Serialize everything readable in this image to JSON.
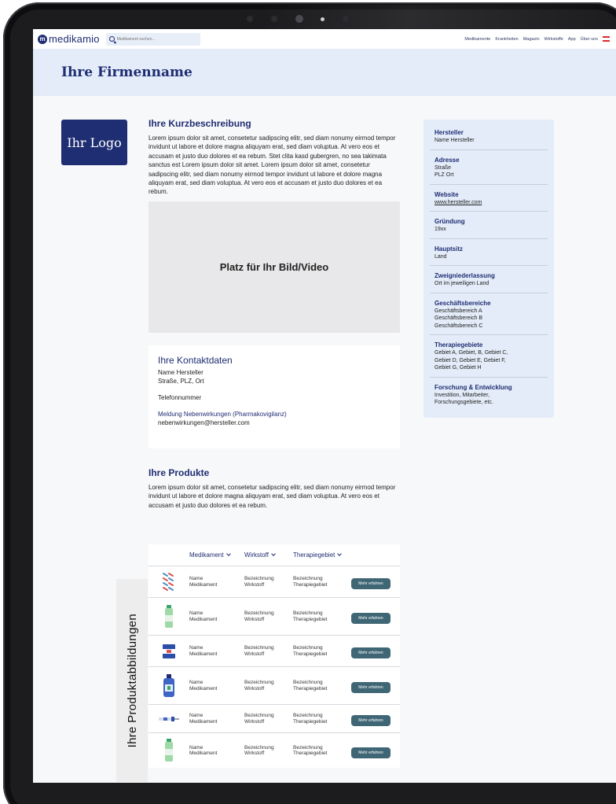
{
  "nav": {
    "brand": "medikamio",
    "brand_mark": "m",
    "search_placeholder": "Medikament suchen...",
    "links": [
      "Medikamente",
      "Krankheiten",
      "Magazin",
      "Wirkstoffe",
      "App",
      "Über uns"
    ]
  },
  "header": {
    "company_name": "Ihre Firmenname"
  },
  "logo": {
    "text": "Ihr Logo"
  },
  "intro": {
    "title": "Ihre Kurzbeschreibung",
    "text": "Lorem ipsum dolor sit amet, consetetur sadipscing elitr, sed diam nonumy eirmod tempor invidunt ut labore et dolore magna aliquyam erat, sed diam voluptua. At vero eos et accusam et justo duo dolores et ea rebum. Stet clita kasd gubergren, no sea takimata sanctus est Lorem ipsum dolor sit amet. Lorem ipsum dolor sit amet, consetetur sadipscing elitr, sed diam nonumy eirmod tempor invidunt ut labore et dolore magna aliquyam erat, sed diam voluptua. At vero eos et accusam et justo duo dolores et ea rebum."
  },
  "media": {
    "placeholder": "Platz für Ihr Bild/Video"
  },
  "contact": {
    "title": "Ihre Kontaktdaten",
    "name": "Name Hersteller",
    "address": "Straße, PLZ, Ort",
    "phone": "Telefonnummer",
    "side_effects_label": "Meldung Nebenwirkungen (Pharmakovigilanz)",
    "email": "nebenwirkungen@hersteller.com"
  },
  "products": {
    "title": "Ihre Produkte",
    "text": "Lorem ipsum dolor sit amet, consetetur sadipscing elitr, sed diam nonumy eirmod tempor invidunt ut labore et dolore magna aliquyam erat, sed diam voluptua. At vero eos et accusam et justo duo dolores et ea rebum.",
    "side_tab": "Ihre Produktabbildungen",
    "columns": [
      "Medikament",
      "Wirkstoff",
      "Therapiegebiet"
    ],
    "rows": [
      {
        "icon": "blister-pack-icon",
        "name1": "Name",
        "name2": "Medikament",
        "wirk1": "Bezeichnung",
        "wirk2": "Wirkstoff",
        "thera1": "Bezeichnung",
        "thera2": "Therapiegebiet",
        "button": "Mehr erfahren"
      },
      {
        "icon": "green-bottle-icon",
        "name1": "Name",
        "name2": "Medikament",
        "wirk1": "Bezeichnung",
        "wirk2": "Wirkstoff",
        "thera1": "Bezeichnung",
        "thera2": "Therapiegebiet",
        "button": "Mehr erfahren"
      },
      {
        "icon": "medicine-box-icon",
        "name1": "Name",
        "name2": "Medikament",
        "wirk1": "Bezeichnung",
        "wirk2": "Wirkstoff",
        "thera1": "Bezeichnung",
        "thera2": "Therapiegebiet",
        "button": "Mehr erfahren"
      },
      {
        "icon": "blue-bottle-icon",
        "name1": "Name",
        "name2": "Medikament",
        "wirk1": "Bezeichnung",
        "wirk2": "Wirkstoff",
        "thera1": "Bezeichnung",
        "thera2": "Therapiegebiet",
        "button": "Mehr erfahren"
      },
      {
        "icon": "syringe-icon",
        "name1": "Name",
        "name2": "Medikament",
        "wirk1": "Bezeichnung",
        "wirk2": "Wirkstoff",
        "thera1": "Bezeichnung",
        "thera2": "Therapiegebiet",
        "button": "Mehr erfahren"
      },
      {
        "icon": "green-bottle-icon",
        "name1": "Name",
        "name2": "Medikament",
        "wirk1": "Bezeichnung",
        "wirk2": "Wirkstoff",
        "thera1": "Bezeichnung",
        "thera2": "Therapiegebiet",
        "button": "Mehr erfahren"
      }
    ]
  },
  "info": [
    {
      "label": "Hersteller",
      "lines": [
        "Name Hersteller"
      ]
    },
    {
      "label": "Adresse",
      "lines": [
        "Straße",
        "PLZ Ort"
      ]
    },
    {
      "label": "Website",
      "lines": [
        "www.hersteller.com"
      ],
      "link": true
    },
    {
      "label": "Gründung",
      "lines": [
        "19xx"
      ]
    },
    {
      "label": "Hauptsitz",
      "lines": [
        "Land"
      ]
    },
    {
      "label": "Zweigniederlassung",
      "lines": [
        "Ort im jeweiligen Land"
      ]
    },
    {
      "label": "Geschäftsbereiche",
      "lines": [
        "Geschäftsbereich A",
        "Geschäftsbereich B",
        "Geschäftsbereich C"
      ]
    },
    {
      "label": "Therapiegebiete",
      "lines": [
        "Gebiet A, Gebiet, B, Gebiet C,",
        "Gebiet D, Gebiet E, Gebiet F,",
        "Gebiet G, Gebiet H"
      ]
    },
    {
      "label": "Forschung & Entwicklung",
      "lines": [
        "Investition, Mitarbeiter,",
        "Forschungsgebiete, etc."
      ]
    }
  ],
  "colors": {
    "brand": "#1f2d72",
    "header_band": "#e3ecf8",
    "button": "#3f6675",
    "device": "#1c1c1f"
  }
}
